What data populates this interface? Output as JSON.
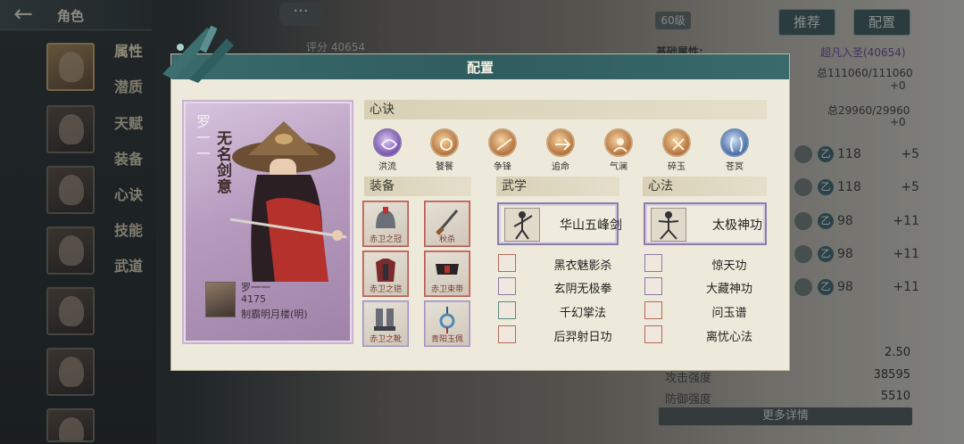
{
  "app": {
    "back_icon": "back-arrow-icon",
    "title": "角色"
  },
  "sidebar": {
    "tabs": [
      {
        "label": "属性"
      },
      {
        "label": "潜质"
      },
      {
        "label": "天赋"
      },
      {
        "label": "装备"
      },
      {
        "label": "心诀"
      },
      {
        "label": "技能"
      },
      {
        "label": "武道"
      }
    ],
    "active_tab": "属性"
  },
  "header": {
    "chat_icon": "···",
    "score_label": "评分",
    "score_value": "40654",
    "level": "60级",
    "recommend_label": "推荐",
    "config_label": "配置"
  },
  "right_panel": {
    "base_attr_label": "基础属性:",
    "realm": "超凡入圣(40654)",
    "total_1": "总111060/111060",
    "plus_1": "+0",
    "total_2": "总29960/29960",
    "plus_2": "+0",
    "skill_rows": [
      {
        "level": "118",
        "bonus": "+5"
      },
      {
        "level": "118",
        "bonus": "+5"
      },
      {
        "level": "98",
        "bonus": "+11"
      },
      {
        "level": "98",
        "bonus": "+11"
      },
      {
        "level": "98",
        "bonus": "+11"
      }
    ],
    "stats": [
      {
        "label": "",
        "value": "2.50"
      },
      {
        "label": "攻击强度",
        "value": "38595"
      },
      {
        "label": "防御强度",
        "value": "5510"
      }
    ],
    "more_details": "更多详情"
  },
  "modal": {
    "title": "配置",
    "character": {
      "name": "罗一一",
      "title": "无名剑意",
      "mini_name": "罗一一",
      "power": "4175",
      "rank": "制霸明月楼(明)"
    },
    "xinjue": {
      "header": "心诀",
      "items": [
        {
          "name": "洪流",
          "style": "purple"
        },
        {
          "name": "饕餮",
          "style": "gold"
        },
        {
          "name": "争锋",
          "style": "gold"
        },
        {
          "name": "追命",
          "style": "gold"
        },
        {
          "name": "气澜",
          "style": "gold"
        },
        {
          "name": "碎玉",
          "style": "gold"
        },
        {
          "name": "苍冥",
          "style": "blue"
        }
      ]
    },
    "equipment": {
      "header": "装备",
      "items": [
        {
          "name": "赤卫之冠",
          "style": "red"
        },
        {
          "name": "秋杀",
          "style": "red"
        },
        {
          "name": "赤卫之铠",
          "style": "red"
        },
        {
          "name": "赤卫束带",
          "style": "red"
        },
        {
          "name": "赤卫之靴",
          "style": "lav"
        },
        {
          "name": "青阳玉佩",
          "style": "lav"
        }
      ]
    },
    "wuxue": {
      "header": "武学",
      "main": "华山五峰剑",
      "list": [
        "黑衣魅影杀",
        "玄阴无极拳",
        "千幻掌法",
        "后羿射日功"
      ]
    },
    "xinfa": {
      "header": "心法",
      "main": "太极神功",
      "list": [
        "惊天功",
        "大藏神功",
        "问玉谱",
        "离忧心法"
      ]
    }
  }
}
